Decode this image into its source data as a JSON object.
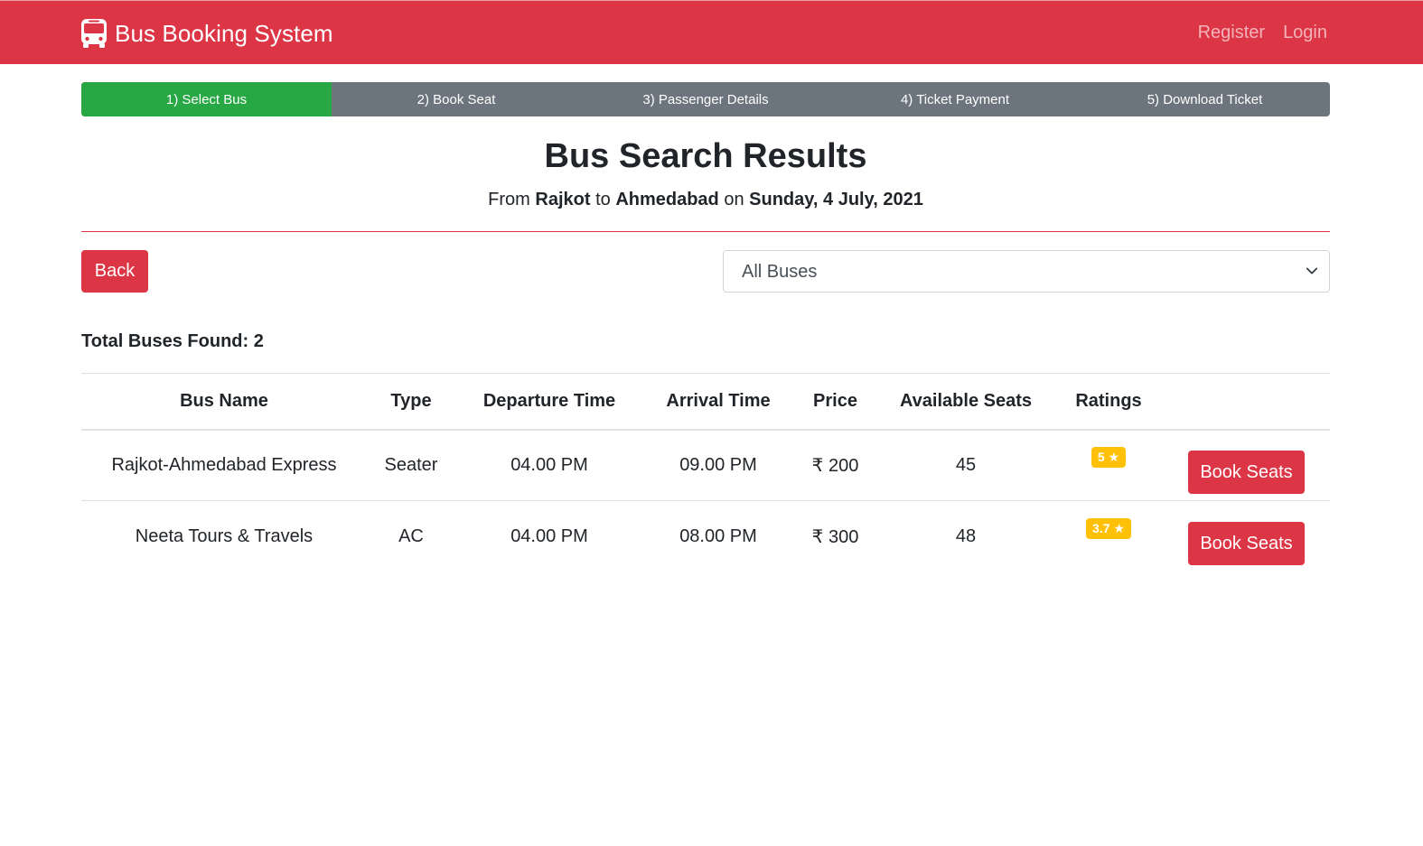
{
  "navbar": {
    "brand": "Bus Booking System",
    "brand_icon": "bus-icon",
    "links": [
      "Register",
      "Login"
    ]
  },
  "steps": [
    "1) Select Bus",
    "2) Book Seat",
    "3) Passenger Details",
    "4) Ticket Payment",
    "5) Download Ticket"
  ],
  "active_step_index": 0,
  "heading": {
    "title": "Bus Search Results",
    "from_prefix": "From",
    "from_city": "Rajkot",
    "to_word": "to",
    "to_city": "Ahmedabad",
    "on_word": "on",
    "date": "Sunday, 4 July, 2021"
  },
  "controls": {
    "back_label": "Back",
    "filter_selected": "All Buses"
  },
  "total_label": "Total Buses Found: 2",
  "table": {
    "headers": [
      "Bus Name",
      "Type",
      "Departure Time",
      "Arrival Time",
      "Price",
      "Available Seats",
      "Ratings",
      ""
    ],
    "rows": [
      {
        "name": "Rajkot-Ahmedabad Express",
        "type": "Seater",
        "departure": "04.00 PM",
        "arrival": "09.00 PM",
        "price": "₹ 200",
        "seats": "45",
        "rating": "5 ★",
        "action": "Book Seats"
      },
      {
        "name": "Neeta Tours & Travels",
        "type": "AC",
        "departure": "04.00 PM",
        "arrival": "08.00 PM",
        "price": "₹ 300",
        "seats": "48",
        "rating": "3.7 ★",
        "action": "Book Seats"
      }
    ]
  },
  "colors": {
    "primary": "#dc3545",
    "success": "#28a745",
    "secondary": "#6c757d",
    "warning": "#ffc107"
  }
}
